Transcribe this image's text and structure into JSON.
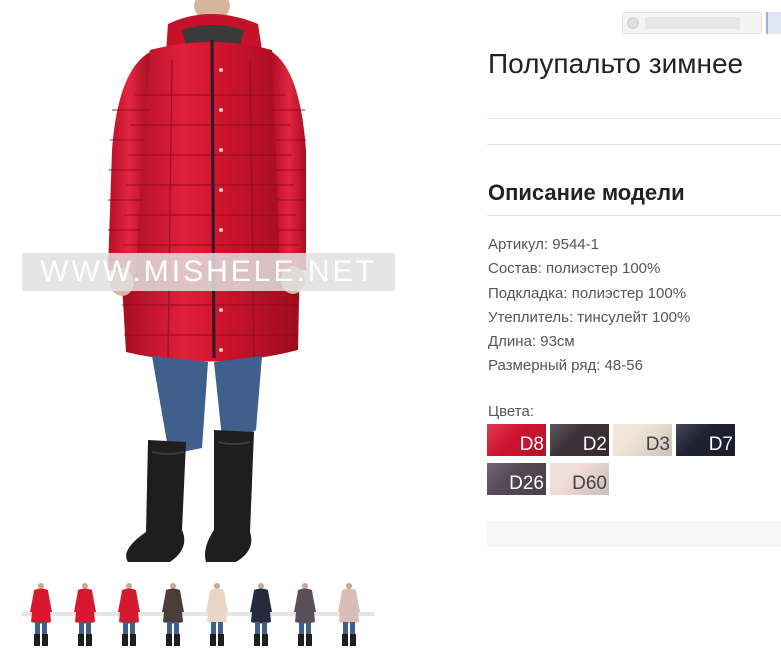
{
  "product": {
    "title": "Полупальто зимнее",
    "watermark": "WWW.MISHELE.NET"
  },
  "description": {
    "heading": "Описание модели",
    "specs": [
      "Артикул: 9544-1",
      "Состав: полиэстер 100%",
      "Подкладка: полиэстер 100%",
      "Утеплитель: тинсулейт 100%",
      "Длина: 93см",
      "Размерный ряд: 48-56"
    ]
  },
  "colors": {
    "label": "Цвета:",
    "swatches": [
      {
        "code": "D8",
        "color": "#d21530"
      },
      {
        "code": "D2",
        "color": "#3b3338"
      },
      {
        "code": "D3",
        "color": "#efe3d6"
      },
      {
        "code": "D7",
        "color": "#1f2233"
      },
      {
        "code": "D26",
        "color": "#554a55"
      },
      {
        "code": "D60",
        "color": "#efdcd8"
      }
    ]
  },
  "thumbnails": [
    {
      "color": "#d8182f",
      "icon": "coat-thumbnail"
    },
    {
      "color": "#d8182f",
      "icon": "coat-thumbnail"
    },
    {
      "color": "#d31a2e",
      "icon": "coat-thumbnail"
    },
    {
      "color": "#4a3d3a",
      "icon": "coat-thumbnail"
    },
    {
      "color": "#e8d7c6",
      "icon": "coat-thumbnail"
    },
    {
      "color": "#252a3d",
      "icon": "coat-thumbnail"
    },
    {
      "color": "#5c5058",
      "icon": "coat-thumbnail"
    },
    {
      "color": "#d8beb6",
      "icon": "coat-thumbnail"
    }
  ],
  "colors_accent": {
    "coat": "#d0142c",
    "coat_dark": "#9e0d1f",
    "jeans": "#3f5f8c",
    "boots": "#1e1e1e"
  }
}
